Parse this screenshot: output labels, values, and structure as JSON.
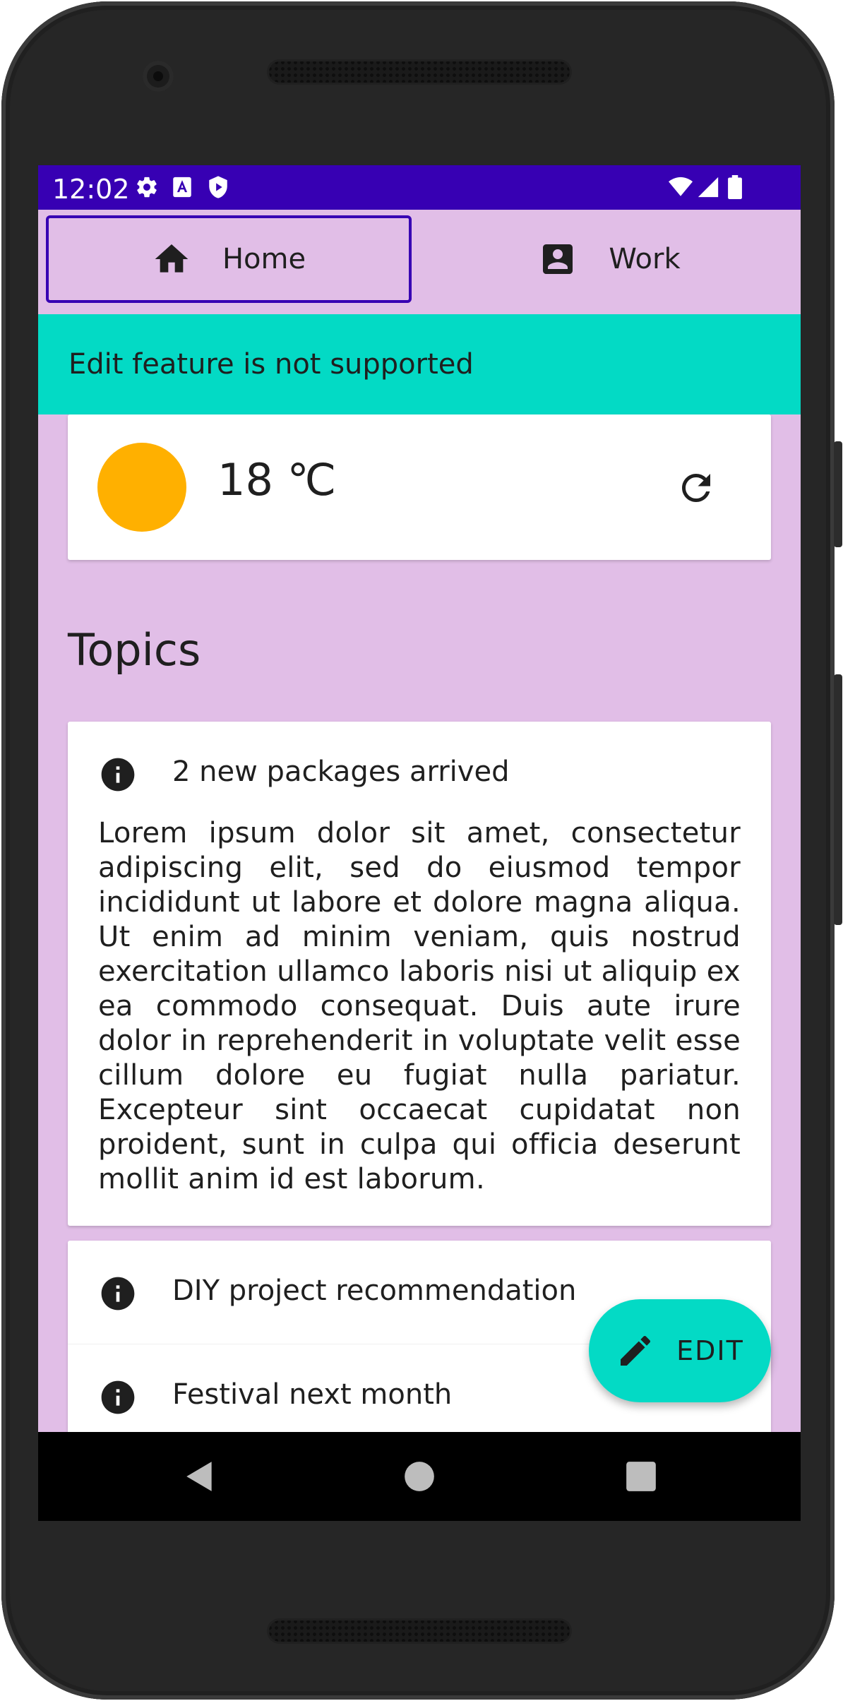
{
  "status_bar": {
    "time": "12:02",
    "left_icons": [
      "settings-icon",
      "app-a-icon",
      "shield-play-icon"
    ],
    "right_icons": [
      "wifi-icon",
      "cell-signal-icon",
      "battery-icon"
    ],
    "background": "#3700b3"
  },
  "tabs": [
    {
      "label": "Home",
      "icon": "home-icon",
      "selected": true
    },
    {
      "label": "Work",
      "icon": "account-box-icon",
      "selected": false
    }
  ],
  "banner": {
    "text": "Edit feature is not supported",
    "color": "#03dac5"
  },
  "weather": {
    "temperature": "18 ℃",
    "sun_color": "#ffb000",
    "refresh_icon": "refresh-icon"
  },
  "topics": {
    "title": "Topics",
    "items": [
      {
        "label": "2 new packages arrived",
        "icon": "info-icon",
        "expanded": true,
        "body": "Lorem ipsum dolor sit amet, consectetur adipiscing elit, sed do eiusmod tempor incididunt ut labore et dolore magna aliqua. Ut enim ad minim veniam, quis nostrud exercitation ullamco laboris nisi ut aliquip ex ea commodo consequat. Duis aute irure dolor in reprehenderit in voluptate velit esse cillum dolore eu fugiat nulla pariatur. Excepteur sint occaecat cupidatat non proident, sunt in culpa qui officia deserunt mollit anim id est laborum."
      },
      {
        "label": "DIY project recommendation",
        "icon": "info-icon",
        "expanded": false
      },
      {
        "label": "Festival next month",
        "icon": "info-icon",
        "expanded": false
      }
    ]
  },
  "fab": {
    "label": "EDIT",
    "icon": "pencil-icon",
    "color": "#03dac5"
  },
  "navigation_bar": {
    "buttons": [
      "back-icon",
      "home-circle-icon",
      "recents-icon"
    ]
  },
  "colors": {
    "background": "#e1bee7",
    "primary": "#3700b3",
    "secondary": "#03dac5"
  }
}
